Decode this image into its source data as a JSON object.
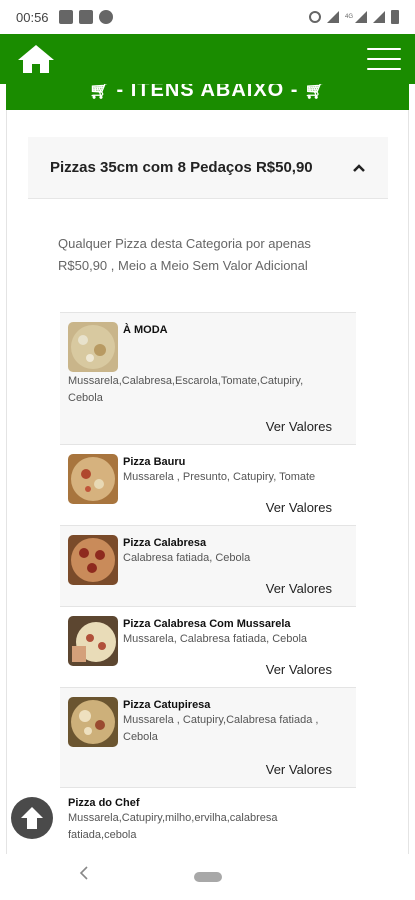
{
  "status_bar": {
    "time": "00:56",
    "network_label": "4G"
  },
  "app_bar": {
    "home_icon": "home-icon",
    "menu_icon": "hamburger-menu-icon",
    "color": "#1a8c00"
  },
  "banner": {
    "text": "- ITENS ABAIXO -"
  },
  "category": {
    "title": "Pizzas 35cm com 8 Pedaços R$50,90",
    "description": "Qualquer Pizza desta Categoria por apenas R$50,90 , Meio a Meio Sem Valor Adicional"
  },
  "items": [
    {
      "name": "À MODA",
      "ingredients": "Mussarela,Calabresa,Escarola,Tomate,Catupiry, Cebola",
      "action": "Ver Valores"
    },
    {
      "name": "Pizza Bauru",
      "ingredients": "Mussarela , Presunto, Catupiry, Tomate",
      "action": "Ver Valores"
    },
    {
      "name": "Pizza Calabresa",
      "ingredients": "Calabresa fatiada, Cebola",
      "action": "Ver Valores"
    },
    {
      "name": "Pizza Calabresa Com Mussarela",
      "ingredients": "Mussarela, Calabresa fatiada, Cebola",
      "action": "Ver Valores"
    },
    {
      "name": "Pizza Catupiresa",
      "ingredients": "Mussarela , Catupiry,Calabresa fatiada , Cebola",
      "action": "Ver Valores"
    },
    {
      "name": "Pizza do Chef",
      "ingredients": "Mussarela,Catupiry,milho,ervilha,calabresa fatiada,cebola"
    }
  ],
  "floating_button": {
    "icon": "arrow-up-icon"
  }
}
